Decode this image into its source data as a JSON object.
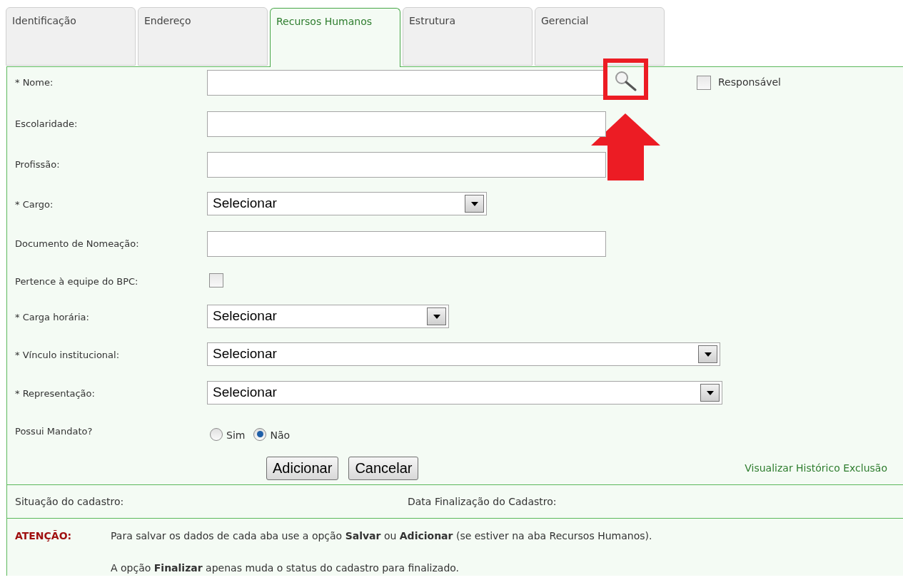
{
  "tabs": [
    {
      "label": "Identificação",
      "selected": false
    },
    {
      "label": "Endereço",
      "selected": false
    },
    {
      "label": "Recursos Humanos",
      "selected": true
    },
    {
      "label": "Estrutura",
      "selected": false
    },
    {
      "label": "Gerencial",
      "selected": false
    }
  ],
  "fields": [
    {
      "kind": "text",
      "label": "* Nome:",
      "search": true,
      "extra_checkbox": {
        "label": "Responsável",
        "checked": false
      }
    },
    {
      "kind": "text",
      "label": "Escolaridade:"
    },
    {
      "kind": "text",
      "label": "Profissão:"
    },
    {
      "kind": "select",
      "label": "* Cargo:",
      "value": "Selecionar"
    },
    {
      "kind": "text",
      "label": "Documento de Nomeação:"
    },
    {
      "kind": "checkbox",
      "label": "Pertence à equipe do BPC:",
      "checked": false
    },
    {
      "kind": "select",
      "label": "* Carga horária:",
      "value": "Selecionar"
    },
    {
      "kind": "select",
      "label": "* Vínculo institucional:",
      "value": "Selecionar"
    },
    {
      "kind": "select",
      "label": "* Representação:",
      "value": "Selecionar"
    },
    {
      "kind": "radio",
      "label": "Possui Mandato?",
      "options": [
        {
          "label": "Sim",
          "selected": false
        },
        {
          "label": "Não",
          "selected": true
        }
      ]
    }
  ],
  "buttons": [
    "Adicionar",
    "Cancelar"
  ],
  "history_link": "Visualizar Histórico Exclusão",
  "status": [
    "Situação do cadastro:",
    "Data Finalização do Cadastro:"
  ],
  "notice": {
    "label": "ATENÇÃO:",
    "lines": [
      "Para salvar os dados de cada aba use a opção **Salvar** ou **Adicionar** (se estiver na aba Recursos Humanos).",
      "A opção **Finalizar** apenas muda o status do cadastro para finalizado."
    ]
  }
}
